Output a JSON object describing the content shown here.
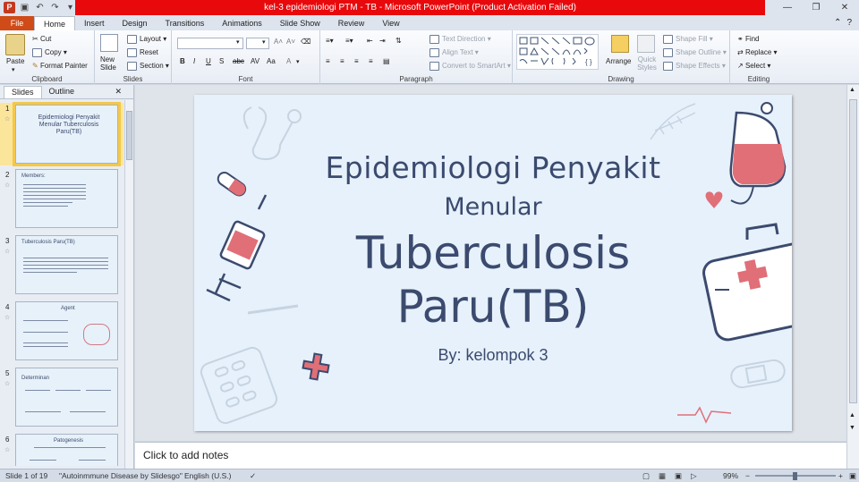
{
  "window": {
    "title": "kel-3 epidemiologi PTM - TB  -  Microsoft PowerPoint (Product Activation Failed)"
  },
  "ribbon_tabs": [
    "File",
    "Home",
    "Insert",
    "Design",
    "Transitions",
    "Animations",
    "Slide Show",
    "Review",
    "View"
  ],
  "ribbon": {
    "clipboard": {
      "paste": "Paste",
      "cut": "Cut",
      "copy": "Copy",
      "format_painter": "Format Painter",
      "label": "Clipboard"
    },
    "slides": {
      "new_slide": "New Slide",
      "layout": "Layout",
      "reset": "Reset",
      "section": "Section",
      "label": "Slides"
    },
    "font": {
      "label": "Font"
    },
    "paragraph": {
      "text_direction": "Text Direction",
      "align_text": "Align Text",
      "convert": "Convert to SmartArt",
      "label": "Paragraph"
    },
    "drawing": {
      "arrange": "Arrange",
      "quick_styles": "Quick Styles",
      "shape_fill": "Shape Fill",
      "shape_outline": "Shape Outline",
      "shape_effects": "Shape Effects",
      "label": "Drawing"
    },
    "editing": {
      "find": "Find",
      "replace": "Replace",
      "select": "Select",
      "label": "Editing"
    }
  },
  "panel": {
    "tabs": [
      "Slides",
      "Outline"
    ],
    "thumbnails": [
      {
        "num": "1",
        "title": "Epidemiologi Penyakit Menular Tuberculosis Paru(TB)"
      },
      {
        "num": "2",
        "title": "Members:"
      },
      {
        "num": "3",
        "title": "Tuberculosis Paru(TB)"
      },
      {
        "num": "4",
        "title": "Agent"
      },
      {
        "num": "5",
        "title": "Determinan"
      },
      {
        "num": "6",
        "title": "Patogenesis"
      }
    ]
  },
  "slide": {
    "line1": "Epidemiologi Penyakit",
    "line2": "Menular",
    "line3": "Tuberculosis",
    "line4": "Paru(TB)",
    "byline": "By: kelompok 3"
  },
  "notes": {
    "placeholder": "Click to add notes"
  },
  "status": {
    "slide_count": "Slide 1 of 19",
    "theme": "\"Autoinmmune Disease by Slidesgo\"",
    "language": "English (U.S.)",
    "zoom": "99%",
    "zoom_level": 0.49
  }
}
